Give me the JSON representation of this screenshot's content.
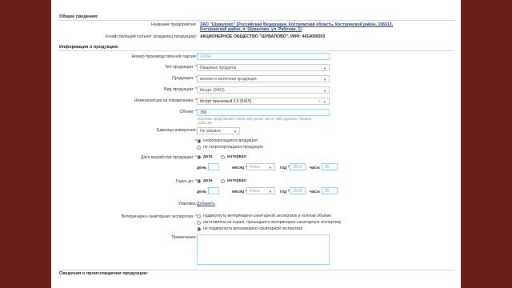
{
  "general": {
    "title": "Общие сведения:",
    "company_label": "Название предприятия:",
    "company_value": "ЗАО \"Шувалово\" (Российская Федерация, Костромская область, Костромской район, 156513, Костромской район, п. Шувалово, ул. Рабочая, 1)",
    "owner_label": "Хозяйствующий субъект (владелец продукции):",
    "owner_value": "АКЦИОНЕРНОЕ ОБЩЕСТВО \"ШУВАЛОВО\", ИНН: 4414000203"
  },
  "product": {
    "title": "Информация о продукции:",
    "batch_label": "Номер производственной партии:",
    "batch_value": "32454",
    "type_label": "Тип продукции:",
    "type_value": "Пищевые продукты",
    "product_label": "Продукция:",
    "product_value": "молоко и молочная продукция",
    "kind_label": "Вид продукции:",
    "kind_value": "йогурт (9403)",
    "nomenclature_label": "Номенклатура из справочника:",
    "nomenclature_value": "йогурт вишневый 2,5 (5415)",
    "volume_label": "Объем:",
    "volume_value": "150",
    "volume_hint": "Значение представляет собой либо целое число, либо дробное. Пример: 1535,125",
    "unit_label": "Единица измерения:",
    "unit_value": "Не указано",
    "perish_options": [
      "скоропортящаяся продукция",
      "не скоропортящаяся продукция"
    ],
    "prod_date_label": "Дата выработки продукции:",
    "expiry_label": "Годен до:",
    "date_option": "дата",
    "interval_option": "интервал",
    "day_label": "день",
    "month_label": "месяц",
    "month_value": "Июнь",
    "year_label": "год",
    "year_value": "2019",
    "hours_label": "часы",
    "hours_value": "00",
    "package_label": "Упаковка:",
    "package_add": "Добавить",
    "vet_label": "Ветеринарно-санитарная экспертиза:",
    "vet_options": [
      "подвергнута ветеринарно-санитарной экспертизе в полном объёме",
      "изготовлена из сырья, прошедшего ветеринарно-санитарную экспертизу",
      "не подвергнута ветеринарно-санитарной экспертизе"
    ],
    "note_label": "Примечание:"
  },
  "origin": {
    "title": "Сведения о происхождении продукции:"
  },
  "required_mark": "*"
}
